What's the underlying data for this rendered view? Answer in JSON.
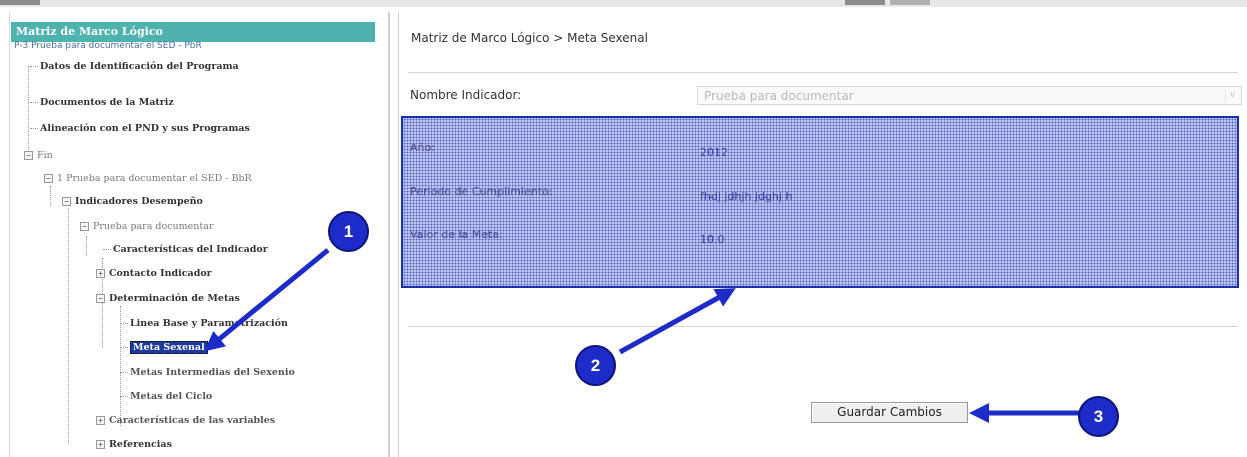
{
  "sidebar": {
    "title": "Matriz de Marco Lógico",
    "program": "P-3 Prueba para documentar el SED - PbR",
    "items": [
      {
        "label": "Datos de Identificación del Programa"
      },
      {
        "label": "Documentos de la Matriz"
      },
      {
        "label": "Alineación con el PND y sus Programas"
      },
      {
        "label": "Fin"
      },
      {
        "label": "1 Prueba para documentar el SED - BbR"
      },
      {
        "label": "Indicadores Desempeño"
      },
      {
        "label": "Prueba para documentar"
      },
      {
        "label": "Características del Indicador"
      },
      {
        "label": "Contacto Indicador"
      },
      {
        "label": "Determinación de Metas"
      },
      {
        "label": "Linea Base y Parametrización"
      },
      {
        "label": "Meta Sexenal"
      },
      {
        "label": "Metas Intermedias del Sexenio"
      },
      {
        "label": "Metas del Ciclo"
      },
      {
        "label": "Características de las variables"
      },
      {
        "label": "Referencias"
      }
    ],
    "expand_glyph": "+",
    "collapse_glyph": "−"
  },
  "main": {
    "breadcrumb": "Matriz de Marco Lógico > Meta Sexenal",
    "indicator_label": "Nombre Indicador:",
    "indicator_value": "Prueba para documentar",
    "dropdown_arrow": "v",
    "fields": [
      {
        "label": "Año:",
        "value": "2012"
      },
      {
        "label": "Periodo de Cumplimiento:",
        "value": "fhdj jdhjh jdghj h"
      },
      {
        "label": "Valor de la Meta:",
        "value": "10.0"
      }
    ],
    "save_button": "Guardar Cambios"
  },
  "callouts": [
    "1",
    "2",
    "3"
  ],
  "colors": {
    "header_teal": "#4eb2ae",
    "selected_bg": "#1f3a9a",
    "callout_blue": "#1d2cc9",
    "highlight_border": "#1a2fb0"
  }
}
